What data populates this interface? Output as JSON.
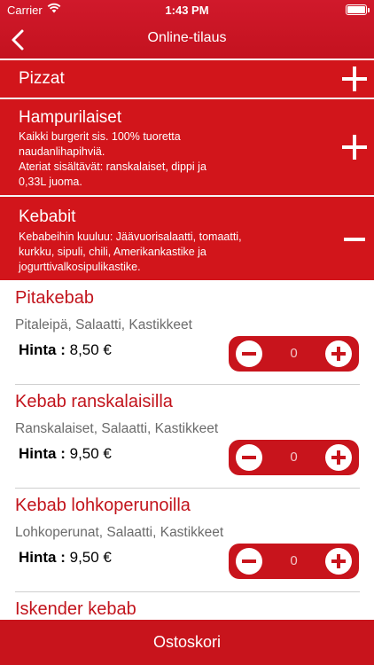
{
  "status": {
    "carrier": "Carrier",
    "time": "1:43 PM",
    "battery_level": 1.0
  },
  "nav": {
    "title": "Online-tilaus",
    "back_icon": "chevron-left-icon"
  },
  "categories": [
    {
      "name": "Pizzat",
      "expanded": false,
      "description_lines": []
    },
    {
      "name": "Hampurilaiset",
      "expanded": false,
      "description_lines": [
        "Kaikki burgerit sis. 100% tuoretta",
        "naudanlihapihviä.",
        "Ateriat sisältävät: ranskalaiset, dippi ja",
        "0,33L juoma."
      ]
    },
    {
      "name": "Kebabit",
      "expanded": true,
      "description_lines": [
        "Kebabeihin kuuluu: Jäävuorisalaatti, tomaatti,",
        "kurkku, sipuli, chili, Amerikankastike ja",
        "jogurttivalkosipulikastike."
      ]
    }
  ],
  "products": [
    {
      "name": "Pitakebab",
      "description": "Pitaleipä, Salaatti, Kastikkeet",
      "price_label": "Hinta :",
      "price": "8,50 €",
      "quantity": "0"
    },
    {
      "name": "Kebab ranskalaisilla",
      "description": "Ranskalaiset, Salaatti, Kastikkeet",
      "price_label": "Hinta :",
      "price": "9,50 €",
      "quantity": "0"
    },
    {
      "name": "Kebab lohkoperunoilla",
      "description": "Lohkoperunat, Salaatti, Kastikkeet",
      "price_label": "Hinta :",
      "price": "9,50 €",
      "quantity": "0"
    },
    {
      "name": "Iskender kebab",
      "description": "",
      "price_label": "",
      "price": "",
      "quantity": ""
    }
  ],
  "cart": {
    "label": "Ostoskori"
  },
  "colors": {
    "brand_red": "#d2151b",
    "product_name": "#c2141c",
    "description_gray": "#6b6b6b"
  }
}
